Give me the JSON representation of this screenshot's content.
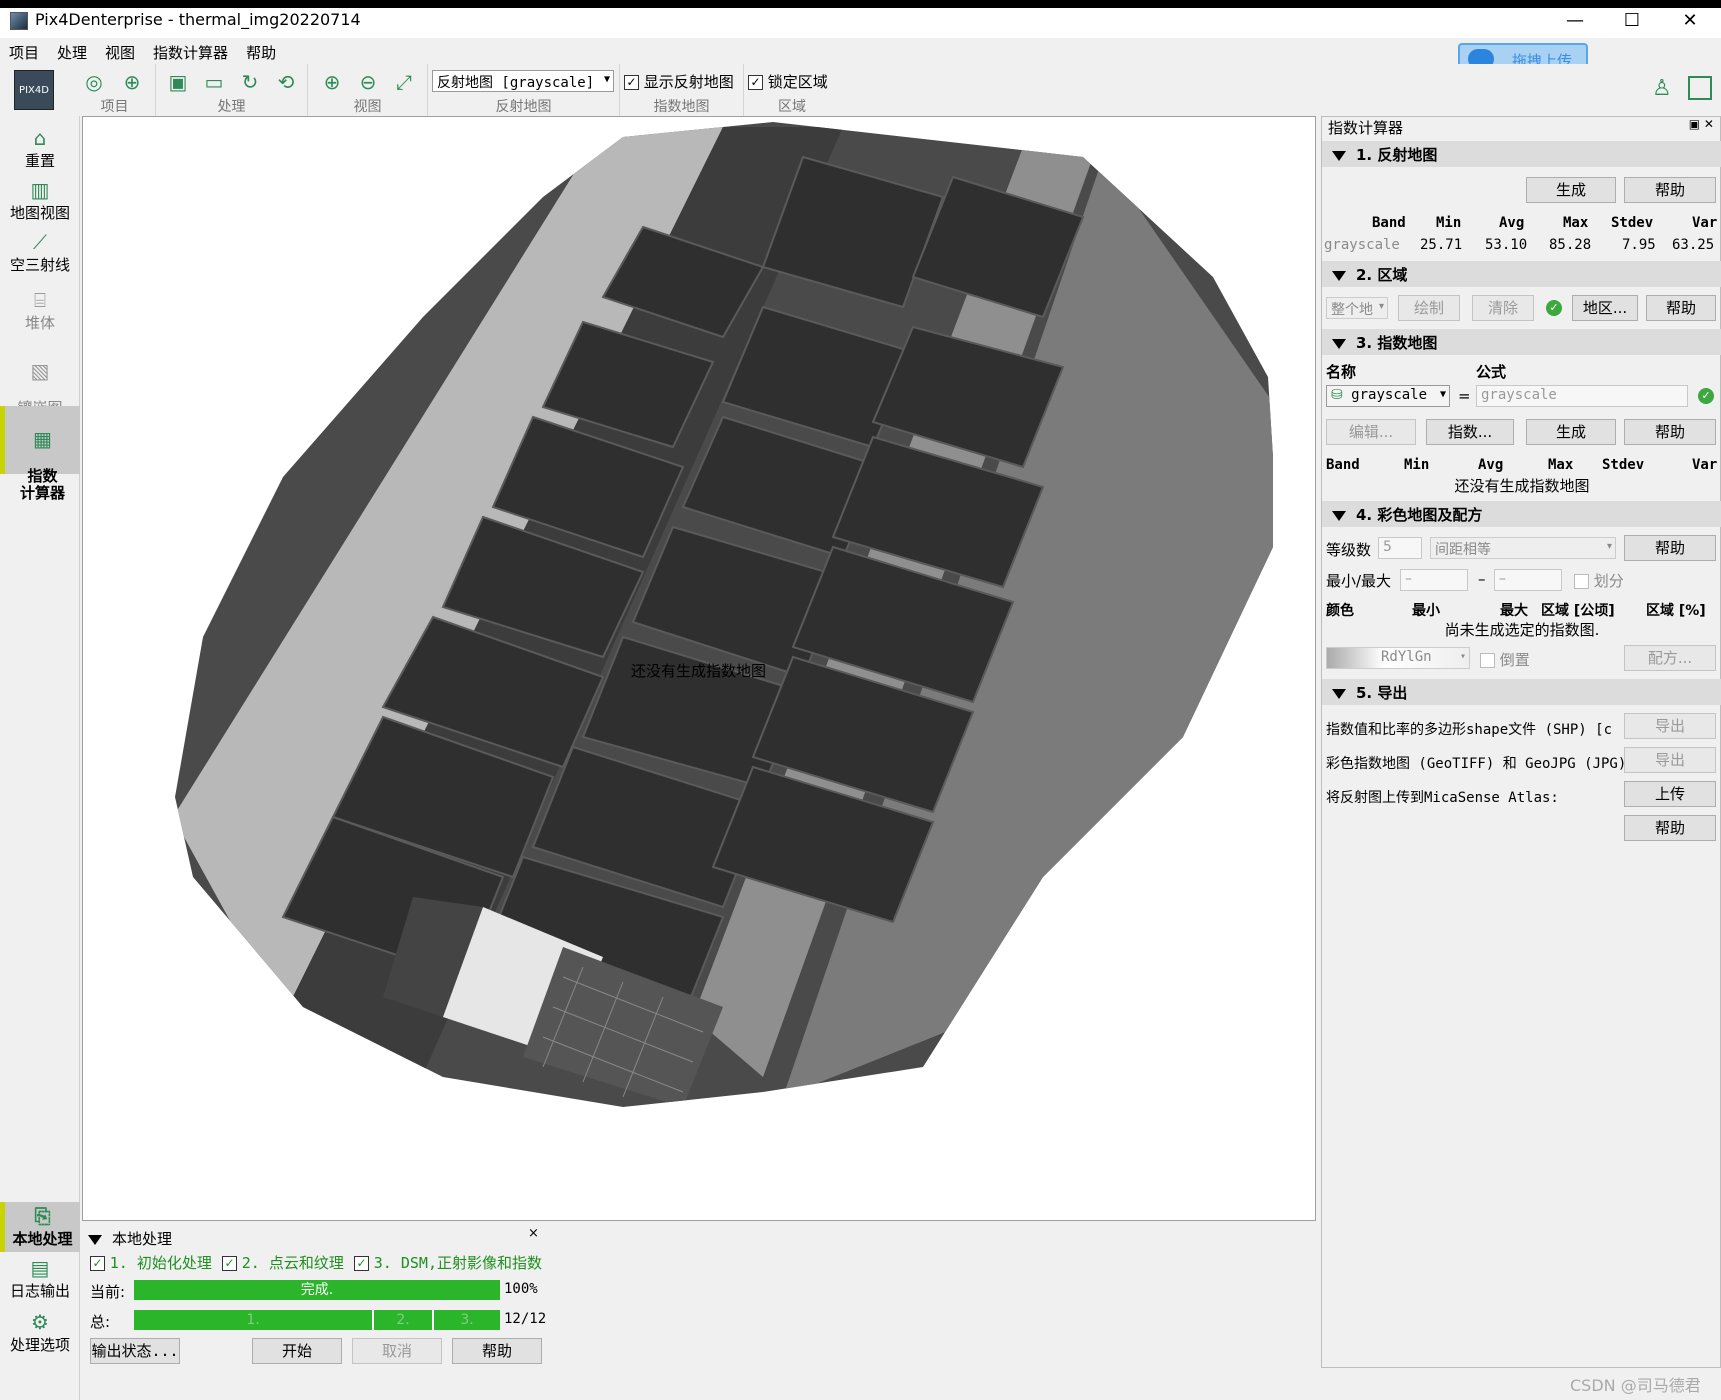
{
  "window": {
    "title": "Pix4Denterprise - thermal_img20220714",
    "controls": {
      "minimize": "—",
      "maximize": "☐",
      "close": "✕"
    }
  },
  "menu": [
    "项目",
    "处理",
    "视图",
    "指数计算器",
    "帮助"
  ],
  "upload_button": "拖拽上传",
  "toolbar": {
    "groups": [
      "项目",
      "处理",
      "视图",
      "反射地图",
      "指数地图",
      "区域"
    ],
    "reflect_combo": "反射地图 [grayscale]",
    "show_reflect_label": "显示反射地图",
    "lock_region_label": "锁定区域"
  },
  "sidebar": {
    "items": [
      "重置",
      "地图视图",
      "空三射线",
      "堆体",
      "镶嵌图\n编辑器",
      "指数\n计算器"
    ],
    "bottom_items": [
      "本地处理",
      "日志输出",
      "处理选项"
    ]
  },
  "map": {
    "message": "还没有生成指数地图"
  },
  "panel": {
    "title": "指数计算器",
    "sec1": {
      "title": "1.  反射地图",
      "generate": "生成",
      "help": "帮助",
      "headers": [
        "Band",
        "Min",
        "Avg",
        "Max",
        "Stdev",
        "Var"
      ],
      "row": [
        "grayscale",
        "25.71",
        "53.10",
        "85.28",
        "7.95",
        "63.25"
      ]
    },
    "sec2": {
      "title": "2.  区域",
      "combo": "整个地",
      "draw": "绘制",
      "clear": "清除",
      "region": "地区...",
      "help": "帮助"
    },
    "sec3": {
      "title": "3.  指数地图",
      "name_label": "名称",
      "formula_label": "公式",
      "name_value": "grayscale",
      "formula_value": "grayscale",
      "edit": "编辑...",
      "index": "指数...",
      "generate": "生成",
      "help": "帮助",
      "headers": [
        "Band",
        "Min",
        "Avg",
        "Max",
        "Stdev",
        "Var"
      ],
      "empty": "还没有生成指数地图"
    },
    "sec4": {
      "title": "4.  彩色地图及配方",
      "levels_label": "等级数",
      "levels_value": "5",
      "spacing": "间距相等",
      "help": "帮助",
      "minmax_label": "最小/最大",
      "min_ph": "–",
      "max_ph": "–",
      "divide": "划分",
      "headers": [
        "颜色",
        "最小",
        "最大",
        "区域 [公顷]",
        "区域 [%]"
      ],
      "empty": "尚未生成选定的指数图.",
      "palette": "RdYlGn",
      "invert": "倒置",
      "recipe": "配方..."
    },
    "sec5": {
      "title": "5.  导出",
      "row1": "指数值和比率的多边形shape文件 (SHP) [c",
      "row2": "彩色指数地图 (GeoTIFF) 和 GeoJPG (JPG)",
      "row3": "将反射图上传到MicaSense Atlas:",
      "export": "导出",
      "upload": "上传",
      "help": "帮助"
    }
  },
  "processing": {
    "title": "本地处理",
    "steps": [
      "1. 初始化处理",
      "2. 点云和纹理",
      "3. DSM,正射影像和指数"
    ],
    "current_label": "当前:",
    "current_text": "完成.",
    "current_pct": "100%",
    "current_progress": 1.0,
    "total_label": "总:",
    "total_segments": [
      "1.",
      "2.",
      "3."
    ],
    "total_value": "12/12",
    "buttons": [
      "输出状态...",
      "开始",
      "取消",
      "帮助"
    ],
    "close": "×"
  },
  "watermark": "CSDN @司马德君",
  "colors": {
    "progress": "#2ab52a",
    "accent_active": "#c8d400",
    "ok": "#3da83d"
  }
}
